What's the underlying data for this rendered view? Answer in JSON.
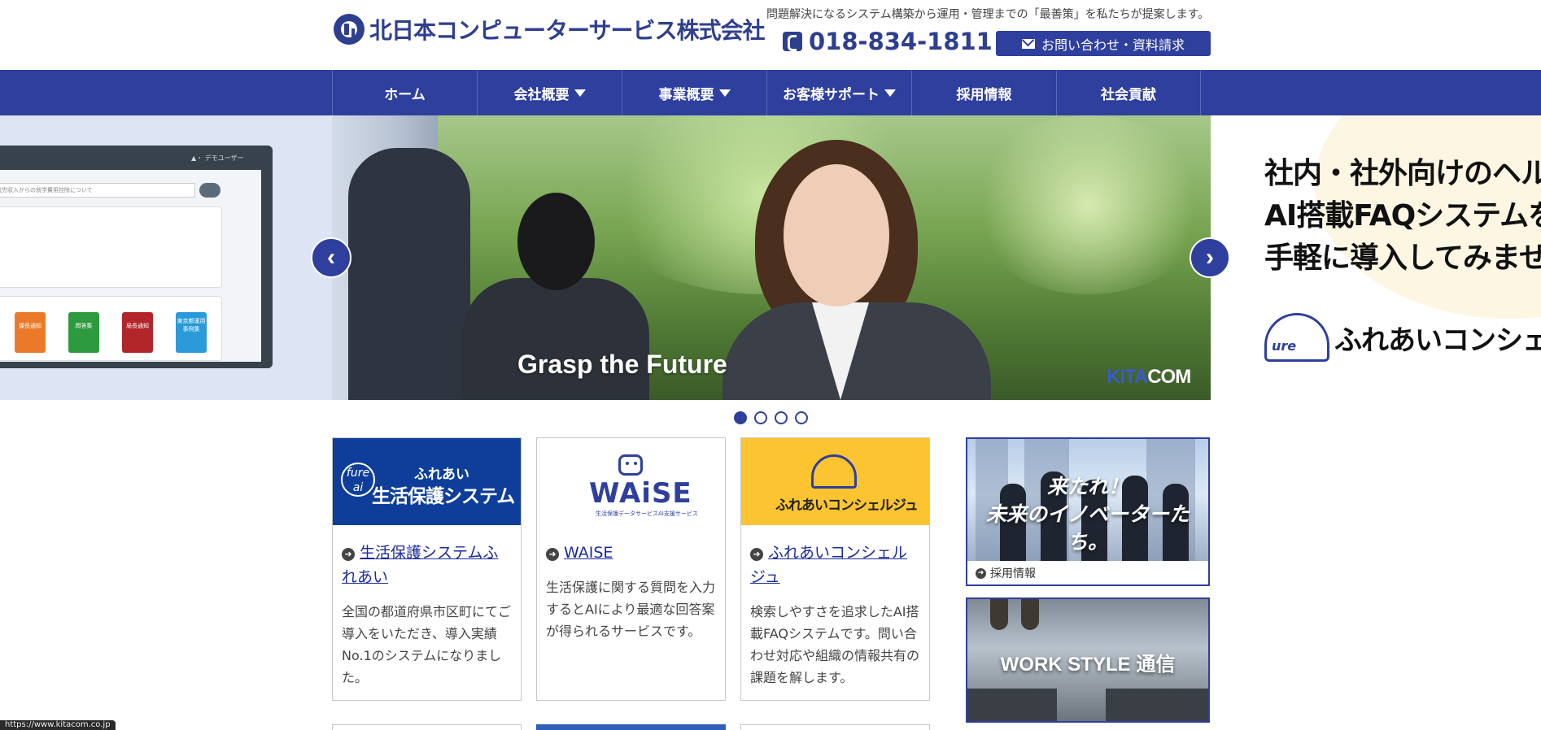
{
  "header": {
    "logo_text": "北日本コンピューターサービス株式会社",
    "tagline": "問題解決になるシステム構築から運用・管理までの「最善策」を私たちが提案します。",
    "phone": "018-834-1811",
    "contact_label": "お問い合わせ・資料請求"
  },
  "nav": {
    "items": [
      {
        "label": "ホーム",
        "dropdown": false
      },
      {
        "label": "会社概要",
        "dropdown": true
      },
      {
        "label": "事業概要",
        "dropdown": true
      },
      {
        "label": "お客様サポート",
        "dropdown": true
      },
      {
        "label": "採用情報",
        "dropdown": false
      },
      {
        "label": "社会貢献",
        "dropdown": false
      }
    ]
  },
  "slider": {
    "left_mock": {
      "search_text": "就労収入からの就学費用控除について",
      "user_label": "デモユーザー",
      "books": [
        "課長通知",
        "問答集",
        "局長通知",
        "東京都運用事例集"
      ]
    },
    "main_caption": "Grasp the Future",
    "main_brand_a": "KITA",
    "main_brand_b": "COM",
    "right_lines": [
      "社内・社外向けのヘル",
      "AI搭載FAQシステムを",
      "手軽に導入してみませ"
    ],
    "right_logo_text": "ふれあいコンシェ",
    "prev_icon": "chevron-left-icon",
    "next_icon": "chevron-right-icon",
    "prev_glyph": "‹",
    "next_glyph": "›",
    "dots": 4,
    "active_dot": 0
  },
  "cards": [
    {
      "img_sub": "ふれあい",
      "img_main": "生活保護システム",
      "img_badge": "fure ai",
      "link": "生活保護システムふれあい",
      "desc": "全国の都道府県市区町にてご導入をいただき、導入実績No.1のシステムになりました。"
    },
    {
      "img_word": "WAiSE",
      "img_small": "生活保護データサービスAI支援サービス",
      "link": "WAISE",
      "desc": "生活保護に関する質問を入力するとAIにより最適な回答案が得られるサービスです。"
    },
    {
      "img_text": "ふれあいコンシェルジュ",
      "link": "ふれあいコンシェルジュ",
      "desc": "検索しやすさを追求したAI搭載FAQシステムです。問い合わせ対応や組織の情報共有の課題を解します。"
    }
  ],
  "banners": {
    "recruit_line1": "来たれ！",
    "recruit_line2": "未来のイノベーターたち。",
    "recruit_caption": "採用情報",
    "workstyle_text": "WORK STYLE 通信"
  },
  "status_url": "https://www.kitacom.co.jp",
  "colors": {
    "brand": "#2f3f9e",
    "link": "#1a2b9a",
    "card3_bg": "#fcc431",
    "card1_bg": "#0e3e9a"
  }
}
